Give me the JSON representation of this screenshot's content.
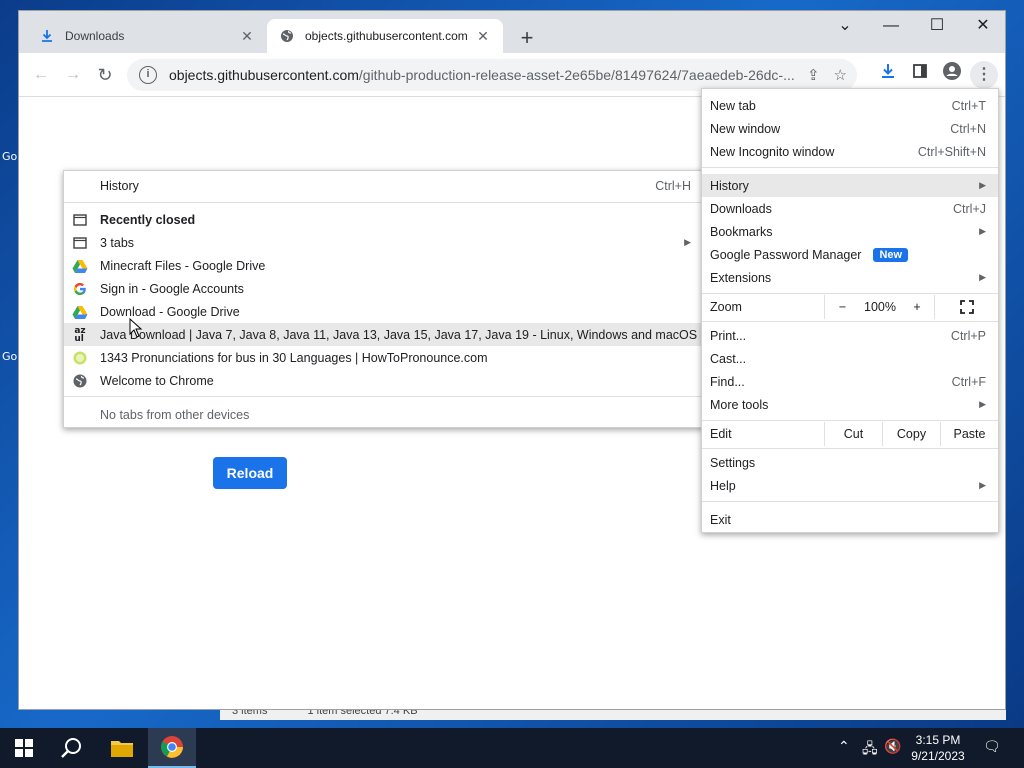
{
  "desktop": {
    "icon_labels": [
      "Go",
      "Go"
    ]
  },
  "explorer_status": {
    "items": "3 items",
    "selected": "1 item selected  7.4 KB"
  },
  "tabs": [
    {
      "title": "Downloads",
      "icon": "download-icon"
    },
    {
      "title": "objects.githubusercontent.com",
      "icon": "globe-icon"
    }
  ],
  "window_controls": {
    "dropdown": "⌄",
    "minimize": "—",
    "maximize": "☐",
    "close": "✕"
  },
  "toolbar": {
    "url_host": "objects.githubusercontent.com",
    "url_path": "/github-production-release-asset-2e65be/81497624/7aeaedeb-26dc-..."
  },
  "page": {
    "reload_label": "Reload"
  },
  "history_menu": {
    "header": {
      "label": "History",
      "shortcut": "Ctrl+H"
    },
    "recently_closed": "Recently closed",
    "items": [
      {
        "label": "3 tabs",
        "icon": "tabs-icon",
        "submenu": true
      },
      {
        "label": "Minecraft Files - Google Drive",
        "icon": "google-drive-icon"
      },
      {
        "label": "Sign in - Google Accounts",
        "icon": "google-icon"
      },
      {
        "label": "Download - Google Drive",
        "icon": "google-drive-icon"
      },
      {
        "label": "Java Download | Java 7, Java 8, Java 11, Java 13, Java 15, Java 17, Java 19 - Linux, Windows and macOS",
        "icon": "azul-icon"
      },
      {
        "label": "1343 Pronunciations for bus in 30 Languages | HowToPronounce.com",
        "icon": "howtopronounce-icon"
      },
      {
        "label": "Welcome to Chrome",
        "icon": "chrome-globe-icon"
      }
    ],
    "footer": "No tabs from other devices"
  },
  "main_menu": {
    "new_tab": {
      "label": "New tab",
      "shortcut": "Ctrl+T"
    },
    "new_window": {
      "label": "New window",
      "shortcut": "Ctrl+N"
    },
    "new_incognito": {
      "label": "New Incognito window",
      "shortcut": "Ctrl+Shift+N"
    },
    "history": {
      "label": "History"
    },
    "downloads": {
      "label": "Downloads",
      "shortcut": "Ctrl+J"
    },
    "bookmarks": {
      "label": "Bookmarks"
    },
    "password_manager": {
      "label": "Google Password Manager",
      "badge": "New"
    },
    "extensions": {
      "label": "Extensions"
    },
    "zoom": {
      "label": "Zoom",
      "minus": "−",
      "value": "100%",
      "plus": "+"
    },
    "print": {
      "label": "Print...",
      "shortcut": "Ctrl+P"
    },
    "cast": {
      "label": "Cast..."
    },
    "find": {
      "label": "Find...",
      "shortcut": "Ctrl+F"
    },
    "more_tools": {
      "label": "More tools"
    },
    "edit": {
      "label": "Edit",
      "cut": "Cut",
      "copy": "Copy",
      "paste": "Paste"
    },
    "settings": {
      "label": "Settings"
    },
    "help": {
      "label": "Help"
    },
    "exit": {
      "label": "Exit"
    }
  },
  "taskbar": {
    "time": "3:15 PM",
    "date": "9/21/2023"
  },
  "colors": {
    "accent": "#1a73e8",
    "taskbar": "#101a2b",
    "desktop": "#1769c9"
  }
}
